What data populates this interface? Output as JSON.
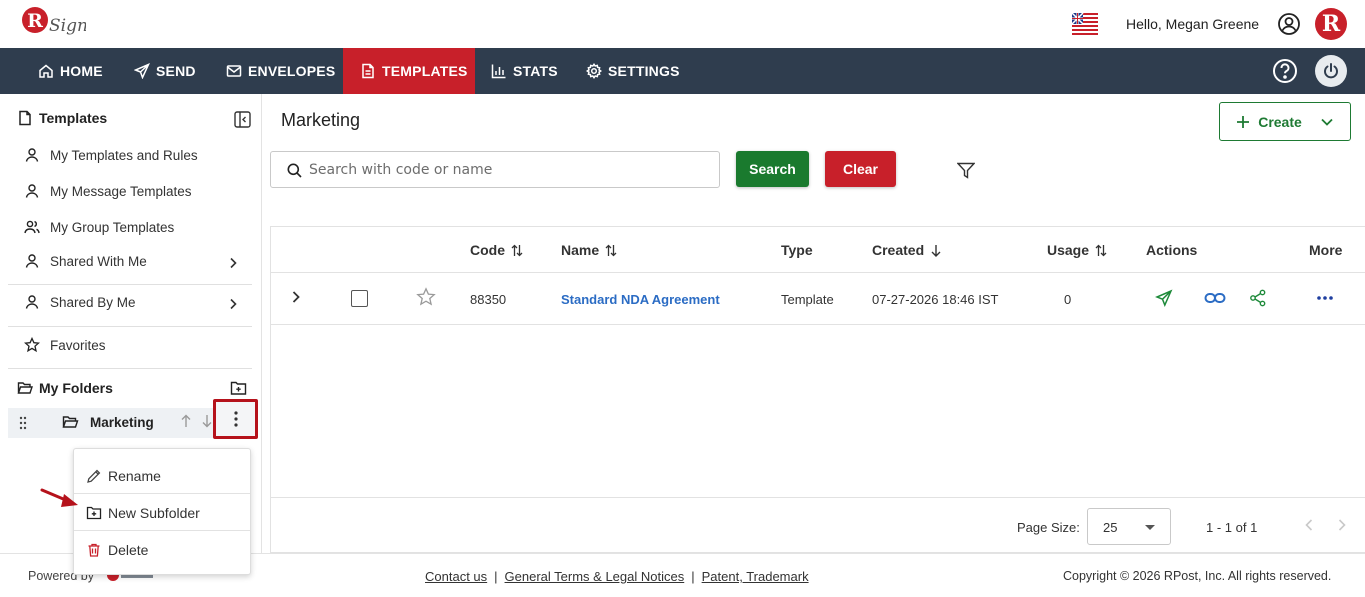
{
  "header": {
    "brand": "RSign",
    "greeting": "Hello, Megan Greene",
    "avatar_letter": "R",
    "language_flag_icon": "uk-flag-icon"
  },
  "nav": {
    "items": [
      {
        "label": "HOME",
        "icon": "home-icon"
      },
      {
        "label": "SEND",
        "icon": "send-icon"
      },
      {
        "label": "ENVELOPES",
        "icon": "envelope-icon"
      },
      {
        "label": "TEMPLATES",
        "icon": "template-icon",
        "active": true
      },
      {
        "label": "STATS",
        "icon": "chart-icon"
      },
      {
        "label": "SETTINGS",
        "icon": "gear-icon"
      }
    ],
    "active_color": "#c8202a",
    "bar_color": "#2f3d4e"
  },
  "sidebar": {
    "title": "Templates",
    "items": [
      {
        "label": "My Templates and Rules"
      },
      {
        "label": "My Message Templates"
      },
      {
        "label": "My Group Templates"
      },
      {
        "label": "Shared With Me"
      },
      {
        "label": "Shared By Me"
      },
      {
        "label": "Favorites"
      }
    ],
    "folders_title": "My Folders",
    "folder": {
      "label": "Marketing"
    }
  },
  "context_menu": {
    "items": [
      {
        "label": "Rename"
      },
      {
        "label": "New Subfolder"
      },
      {
        "label": "Delete"
      }
    ]
  },
  "main": {
    "title": "Marketing",
    "create_label": "Create",
    "search_placeholder": "Search with code or name",
    "search_label": "Search",
    "clear_label": "Clear",
    "columns": {
      "code": "Code",
      "name": "Name",
      "type": "Type",
      "created": "Created",
      "usage": "Usage",
      "actions": "Actions",
      "more": "More"
    },
    "rows": [
      {
        "code": "88350",
        "name": "Standard NDA Agreement",
        "type": "Template",
        "created": "07-27-2026 18:46 IST",
        "usage": "0"
      }
    ],
    "page_size_label": "Page Size:",
    "page_size": "25",
    "range": "1 - 1 of 1"
  },
  "footer": {
    "powered_by": "Powered by",
    "links": [
      "Contact us",
      "General Terms & Legal Notices",
      "Patent, Trademark"
    ],
    "copyright": "Copyright © 2026 RPost, Inc. All rights reserved."
  },
  "colors": {
    "green": "#1a7a2e",
    "red": "#c8202a",
    "link_blue": "#2b6cc4",
    "highlight_border": "#b5121b"
  }
}
